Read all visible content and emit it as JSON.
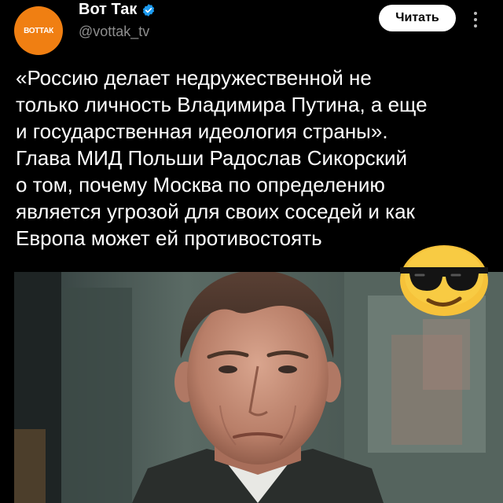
{
  "header": {
    "avatar_logo": "ВОТТАК",
    "display_name": "Вот Так",
    "handle": "@vottak_tv",
    "follow_label": "Читать"
  },
  "tweet": {
    "lines": [
      "«Россию делает недружественной не",
      "только личность Владимира Путина, а еще",
      "и государственная идеология страны».",
      "Глава МИД Польши Радослав Сикорский",
      "о том, почему Москва по определению",
      "является угрозой для своих соседей и как",
      "Европа может ей противостоять"
    ]
  },
  "icons": {
    "verified": "verified-badge-icon",
    "more": "more-vertical-icon",
    "emoji": "sunglasses-emoji-icon"
  },
  "colors": {
    "brand_orange": "#f07f12",
    "verified_blue": "#1d9bf0",
    "emoji_yellow": "#f6c23a",
    "handle_gray": "#8f8f8f"
  }
}
